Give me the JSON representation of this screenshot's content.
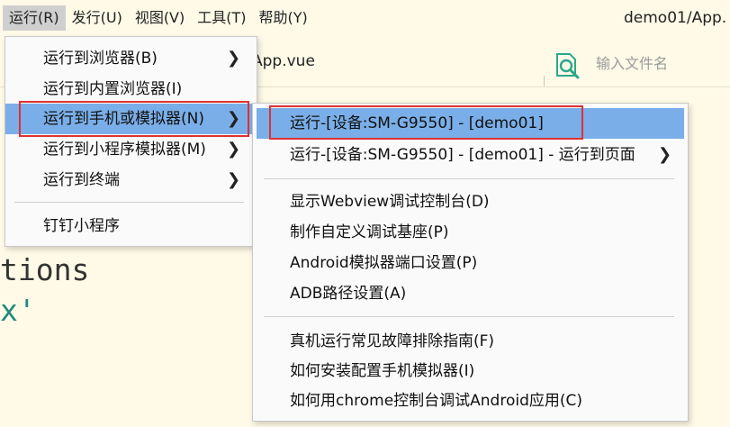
{
  "menubar": {
    "items": [
      "运行(R)",
      "发行(U)",
      "视图(V)",
      "工具(T)",
      "帮助(Y)"
    ],
    "window_title": "demo01/App."
  },
  "editor": {
    "tab_label": "App.vue",
    "file_search_placeholder": "输入文件名",
    "code_lines": [
      "tions",
      "x'"
    ]
  },
  "run_menu": {
    "items": [
      {
        "label": "运行到浏览器(B)",
        "submenu": true
      },
      {
        "label": "运行到内置浏览器(I)",
        "submenu": false
      },
      {
        "label": "运行到手机或模拟器(N)",
        "submenu": true
      },
      {
        "label": "运行到小程序模拟器(M)",
        "submenu": true
      },
      {
        "label": "运行到终端",
        "submenu": true
      },
      {
        "label": "钉钉小程序",
        "submenu": false
      }
    ]
  },
  "phone_menu": {
    "items": [
      {
        "label": "运行-[设备:SM-G9550] - [demo01]",
        "submenu": false
      },
      {
        "label": "运行-[设备:SM-G9550] - [demo01] - 运行到页面",
        "submenu": true
      },
      {
        "label": "显示Webview调试控制台(D)",
        "submenu": false
      },
      {
        "label": "制作自定义调试基座(P)",
        "submenu": false
      },
      {
        "label": "Android模拟器端口设置(P)",
        "submenu": false
      },
      {
        "label": "ADB路径设置(A)",
        "submenu": false
      },
      {
        "label": "真机运行常见故障排除指南(F)",
        "submenu": false
      },
      {
        "label": "如何安装配置手机模拟器(I)",
        "submenu": false
      },
      {
        "label": "如何用chrome控制台调试Android应用(C)",
        "submenu": false
      }
    ]
  },
  "colors": {
    "highlight": "#7aaee8",
    "annotation_box": "#e03030",
    "background": "#fffae8"
  }
}
